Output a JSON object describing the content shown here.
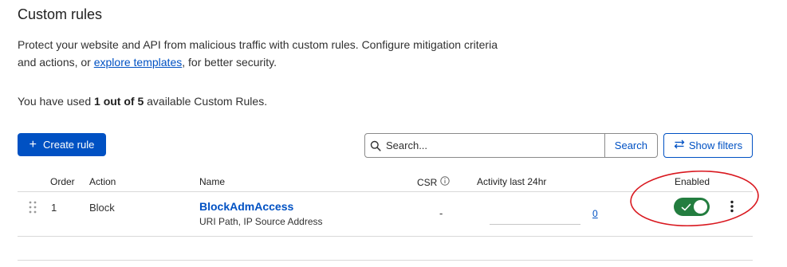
{
  "header": {
    "title": "Custom rules",
    "description_before": "Protect your website and API from malicious traffic with custom rules. Configure mitigation criteria and actions, or ",
    "description_link": "explore templates",
    "description_after": ", for better security."
  },
  "usage": {
    "prefix": "You have used ",
    "count": "1 out of 5",
    "suffix": " available Custom Rules."
  },
  "toolbar": {
    "create_label": "Create rule",
    "search_placeholder": "Search...",
    "search_button": "Search",
    "filters_label": "Show filters"
  },
  "table": {
    "columns": {
      "order": "Order",
      "action": "Action",
      "name": "Name",
      "csr": "CSR",
      "activity": "Activity last 24hr",
      "enabled": "Enabled"
    },
    "rows": [
      {
        "order": "1",
        "action": "Block",
        "name": "BlockAdmAccess",
        "subtitle": "URI Path, IP Source Address",
        "csr": "-",
        "activity": "0",
        "enabled": true
      }
    ]
  },
  "icons": {
    "create": "plus-icon",
    "search": "search-icon",
    "filters": "swap-arrows-icon",
    "csr_info": "info-icon",
    "drag": "drag-handle-icon",
    "toggle": "check-icon",
    "menu": "kebab-menu-icon"
  },
  "colors": {
    "accent": "#0051c3",
    "toggle_on": "#237d3f",
    "annotation": "#d9181f"
  }
}
